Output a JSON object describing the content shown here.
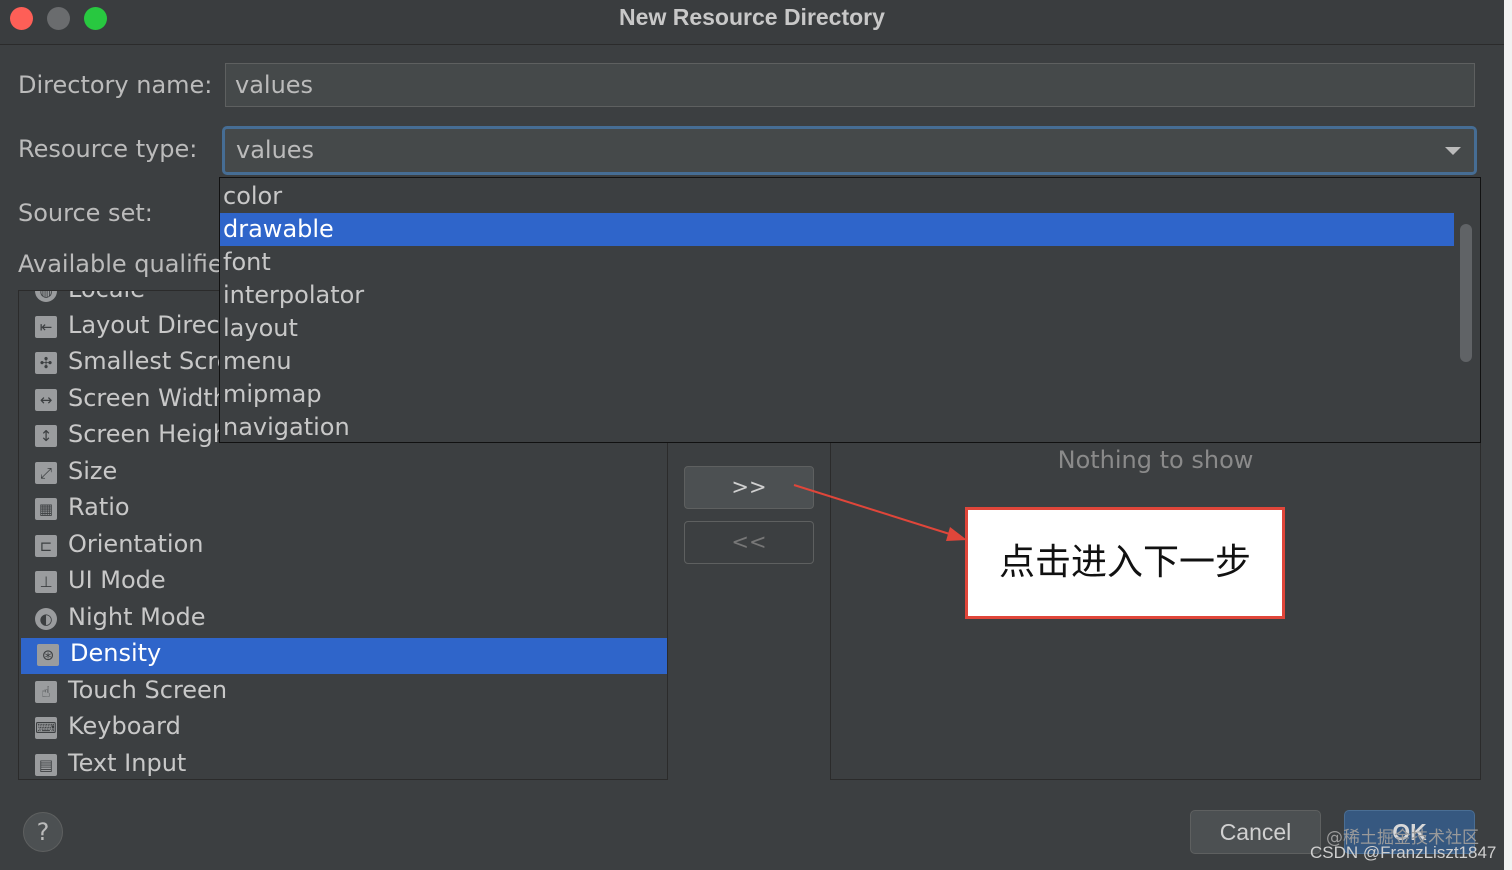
{
  "window": {
    "title": "New Resource Directory"
  },
  "form": {
    "directory_name_label": "Directory name:",
    "directory_name_value": "values",
    "resource_type_label": "Resource type:",
    "resource_type_value": "values",
    "source_set_label": "Source set:",
    "available_qualifiers_label": "Available qualifie"
  },
  "dropdown": {
    "options": [
      "color",
      "drawable",
      "font",
      "interpolator",
      "layout",
      "menu",
      "mipmap",
      "navigation"
    ],
    "selected": "drawable"
  },
  "qualifiers": {
    "items": [
      {
        "label": "Locale",
        "icon": "globe-icon"
      },
      {
        "label": "Layout Direct",
        "icon": "layout-direction-icon"
      },
      {
        "label": "Smallest Scre",
        "icon": "smallest-screen-icon"
      },
      {
        "label": "Screen Width",
        "icon": "screen-width-icon"
      },
      {
        "label": "Screen Heigh",
        "icon": "screen-height-icon"
      },
      {
        "label": "Size",
        "icon": "size-icon"
      },
      {
        "label": "Ratio",
        "icon": "ratio-icon"
      },
      {
        "label": "Orientation",
        "icon": "orientation-icon"
      },
      {
        "label": "UI Mode",
        "icon": "ui-mode-icon"
      },
      {
        "label": "Night Mode",
        "icon": "night-mode-icon"
      },
      {
        "label": "Density",
        "icon": "density-icon"
      },
      {
        "label": "Touch Screen",
        "icon": "touch-screen-icon"
      },
      {
        "label": "Keyboard",
        "icon": "keyboard-icon"
      },
      {
        "label": "Text Input",
        "icon": "text-input-icon"
      }
    ],
    "selected": "Density"
  },
  "buttons": {
    "add": ">>",
    "remove": "<<",
    "help": "?",
    "cancel": "Cancel",
    "ok": "OK"
  },
  "chosen_qualifiers": {
    "empty_text": "Nothing to show"
  },
  "annotation": {
    "text": "点击进入下一步",
    "color": "#e0463a"
  },
  "watermark": {
    "line1": "@稀土掘金技术社区",
    "line2": "CSDN @FranzLiszt1847"
  },
  "colors": {
    "accent": "#2f65ca",
    "background": "#3c3f41"
  }
}
